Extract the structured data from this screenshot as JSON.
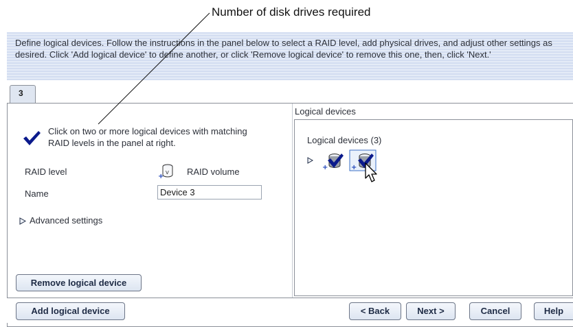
{
  "callout": {
    "text": "Number of disk drives required"
  },
  "banner": {
    "text": "Define logical devices.  Follow the instructions in the panel below to select a RAID level, add physical drives, and adjust other settings as desired.  Click 'Add logical device' to define another, or click 'Remove logical device' to remove this one, then, click 'Next.'"
  },
  "tabs": [
    {
      "label": "3"
    }
  ],
  "left_panel": {
    "instruction": "Click on two or more logical devices with matching RAID levels in the panel at right.",
    "raid_level_label": "RAID level",
    "raid_level_value": "RAID volume",
    "name_label": "Name",
    "name_value": "Device 3",
    "advanced_settings": "Advanced settings",
    "remove_button": "Remove logical device"
  },
  "right_panel": {
    "title": "Logical devices",
    "tree_label": "Logical devices (3)"
  },
  "footer": {
    "add_button": "Add logical device",
    "back_button": "< Back",
    "next_button": "Next >",
    "cancel_button": "Cancel",
    "help_button": "Help"
  },
  "icons": {
    "check": "checkmark-icon",
    "raid": "raid-volume-icon",
    "device": "logical-device-icon",
    "cursor": "mouse-pointer-icon"
  },
  "colors": {
    "banner_bg": "#d6e1f3",
    "check_blue": "#0b1a8c",
    "button_text": "#1d2a44"
  }
}
